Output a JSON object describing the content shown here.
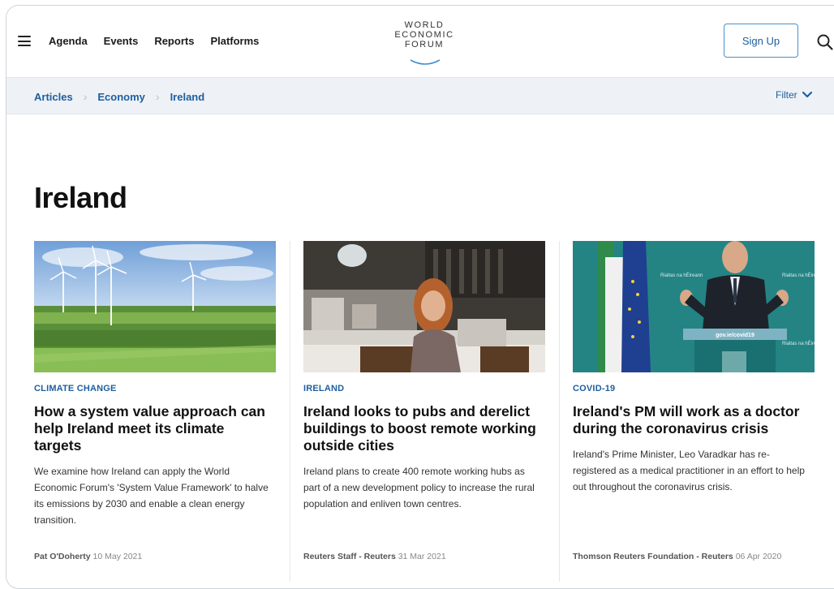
{
  "header": {
    "nav": [
      "Agenda",
      "Events",
      "Reports",
      "Platforms"
    ],
    "logo_lines": [
      "WORLD",
      "ECONOMIC",
      "FORUM"
    ],
    "signup_label": "Sign Up"
  },
  "breadcrumb": {
    "items": [
      "Articles",
      "Economy",
      "Ireland"
    ],
    "filter_label": "Filter"
  },
  "page_title": "Ireland",
  "articles": [
    {
      "tag": "CLIMATE CHANGE",
      "headline": "How a system value approach can help Ireland meet its climate targets",
      "summary": "We examine how Ireland can apply the World Economic Forum's 'System Value Framework' to halve its emissions by 2030 and enable a clean energy transition.",
      "author": "Pat O'Doherty",
      "date": "10 May 2021"
    },
    {
      "tag": "IRELAND",
      "headline": "Ireland looks to pubs and derelict buildings to boost remote working outside cities",
      "summary": "Ireland plans to create 400 remote working hubs as part of a new development policy to increase the rural population and enliven town centres.",
      "author": "Reuters Staff - Reuters",
      "date": "31 Mar 2021"
    },
    {
      "tag": "COVID-19",
      "headline": "Ireland's PM will work as a doctor during the coronavirus crisis",
      "summary": "Ireland's Prime Minister, Leo Varadkar has re-registered as a medical practitioner in an effort to help out throughout the coronavirus crisis.",
      "author": "Thomson Reuters Foundation - Reuters",
      "date": "06 Apr 2020",
      "podium_text": "gov.ie/covid19",
      "backdrop_text": "Rialtas na hÉireann"
    }
  ],
  "colors": {
    "accent": "#1d5fa0",
    "breadcrumb_bg": "#eef1f5",
    "text": "#111111"
  }
}
